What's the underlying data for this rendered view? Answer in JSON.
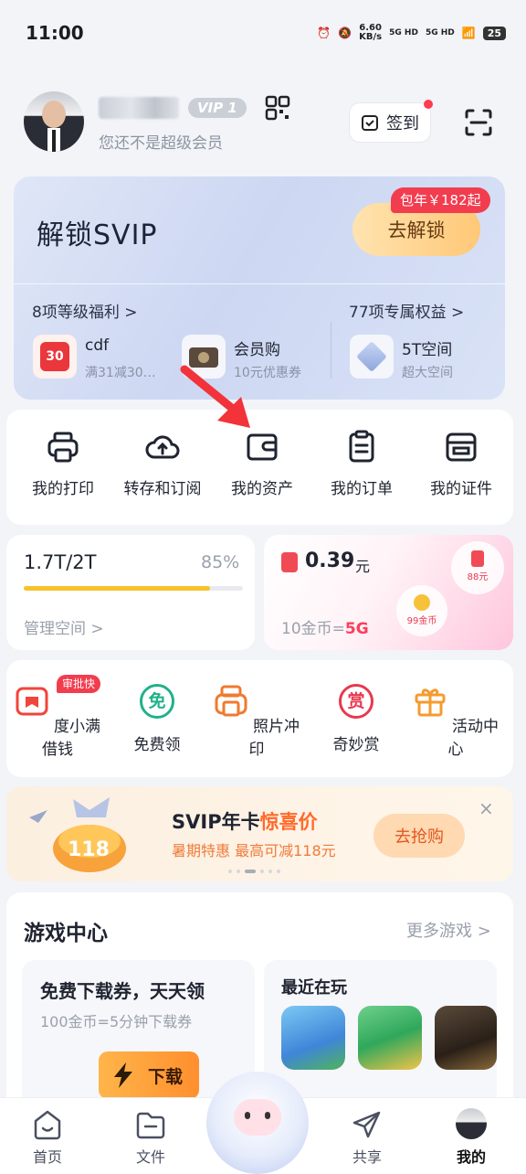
{
  "status_bar": {
    "time": "11:00",
    "net_speed": "6.60",
    "net_unit": "KB/s",
    "sig1": "5G HD",
    "sig2": "5G HD",
    "battery": "25"
  },
  "profile": {
    "vip_level": "VIP 1",
    "membership_text": "您还不是超级会员",
    "signin_label": "签到"
  },
  "svip": {
    "title": "解锁SVIP",
    "price_tag": "包年￥182起",
    "unlock_label": "去解锁",
    "benefits_left": "8项等级福利 >",
    "benefits_right": "77项专属权益 >",
    "perks": [
      {
        "name": "cdf",
        "sub": "满31减30…",
        "icon_text": "30"
      },
      {
        "name": "会员购",
        "sub": "10元优惠券"
      },
      {
        "name": "5T空间",
        "sub": "超大空间"
      }
    ]
  },
  "tools": [
    {
      "label": "我的打印",
      "icon": "printer-icon"
    },
    {
      "label": "转存和订阅",
      "icon": "cloud-upload-icon"
    },
    {
      "label": "我的资产",
      "icon": "wallet-icon"
    },
    {
      "label": "我的订单",
      "icon": "clipboard-icon"
    },
    {
      "label": "我的证件",
      "icon": "id-card-icon"
    }
  ],
  "storage": {
    "used": "1.7T/2T",
    "percent_text": "85%",
    "percent_value": 0.85,
    "manage_label": "管理空间 >"
  },
  "coins": {
    "cash_amount": "0.39",
    "cash_unit": "元",
    "rate_prefix": "10金币=",
    "rate_value": "5G",
    "bubble_cash": "88元",
    "bubble_coins": "99金币"
  },
  "services": {
    "fast_tag": "审批快",
    "items": [
      {
        "label": "度小满借钱",
        "icon": "book-icon",
        "color": "#f0453a"
      },
      {
        "label": "免费领",
        "icon": "free-badge-icon",
        "glyph": "免",
        "color": "#1fb28a"
      },
      {
        "label": "照片冲印",
        "icon": "photo-print-icon",
        "color": "#f07a2e"
      },
      {
        "label": "奇妙赏",
        "icon": "reward-icon",
        "glyph": "赏",
        "color": "#e8384f"
      },
      {
        "label": "活动中心",
        "icon": "gift-icon",
        "color": "#f59b2e"
      }
    ]
  },
  "promo": {
    "art_text": "118",
    "title_prefix": "SVIP年卡",
    "title_highlight": "惊喜价",
    "subtitle": "暑期特惠 最高可减118元",
    "button_label": "去抢购",
    "close_glyph": "×"
  },
  "games": {
    "title": "游戏中心",
    "more_label": "更多游戏 >",
    "voucher_title": "免费下载券，天天领",
    "voucher_sub": "100金币=5分钟下载券",
    "download_label": "下载",
    "recent_title": "最近在玩"
  },
  "tabbar": [
    {
      "label": "首页",
      "icon": "home-icon"
    },
    {
      "label": "文件",
      "icon": "folder-icon"
    },
    {
      "label": "共享",
      "icon": "share-icon"
    },
    {
      "label": "我的",
      "icon": "profile-avatar-icon",
      "active": true
    }
  ],
  "colors": {
    "accent_red": "#f23d4f",
    "progress_yellow": "#f6c32c",
    "brand_orange": "#ff8f2e",
    "svip_bg": "#d9e2f6"
  }
}
